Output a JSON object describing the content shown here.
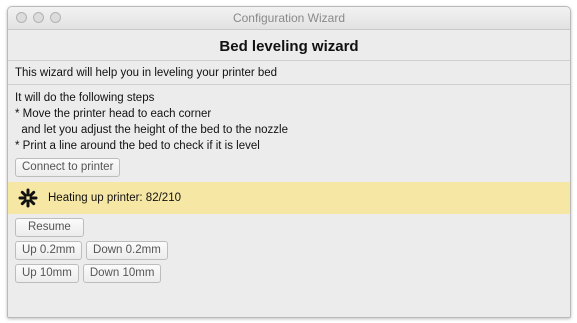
{
  "window": {
    "title": "Configuration Wizard"
  },
  "page": {
    "heading": "Bed leveling wizard",
    "intro": "This wizard will help you in leveling your printer bed",
    "steps": [
      "It will do the following steps",
      "* Move the printer head to each corner",
      "  and let you adjust the height of the bed to the nozzle",
      "* Print a line around the bed to check if it is level"
    ]
  },
  "buttons": {
    "connect": "Connect to printer",
    "resume": "Resume",
    "up_small": "Up 0.2mm",
    "down_small": "Down 0.2mm",
    "up_large": "Up 10mm",
    "down_large": "Down 10mm"
  },
  "status": {
    "icon": "spinner-icon",
    "text": "Heating up printer: 82/210",
    "background": "#f7e7a4"
  }
}
